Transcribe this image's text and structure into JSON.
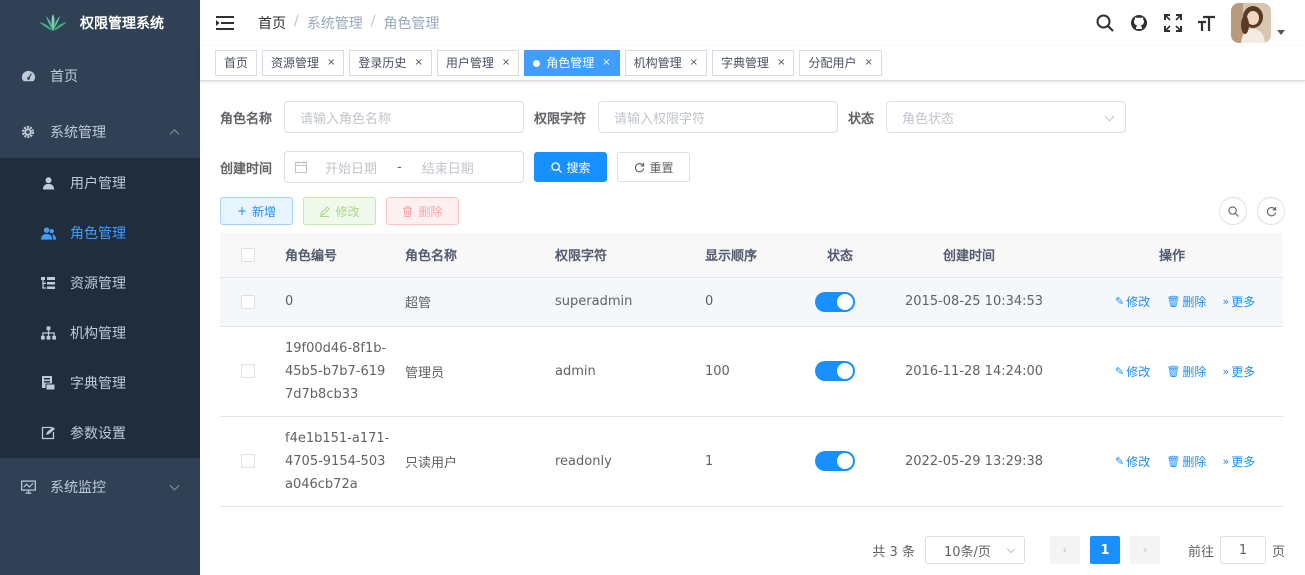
{
  "app": {
    "title": "权限管理系统"
  },
  "sidebar": {
    "home": "首页",
    "system": "系统管理",
    "items": [
      "用户管理",
      "角色管理",
      "资源管理",
      "机构管理",
      "字典管理",
      "参数设置"
    ],
    "monitor": "系统监控"
  },
  "breadcrumb": [
    "首页",
    "系统管理",
    "角色管理"
  ],
  "tags": [
    {
      "label": "首页",
      "closable": false,
      "active": false
    },
    {
      "label": "资源管理",
      "closable": true,
      "active": false
    },
    {
      "label": "登录历史",
      "closable": true,
      "active": false
    },
    {
      "label": "用户管理",
      "closable": true,
      "active": false
    },
    {
      "label": "角色管理",
      "closable": true,
      "active": true
    },
    {
      "label": "机构管理",
      "closable": true,
      "active": false
    },
    {
      "label": "字典管理",
      "closable": true,
      "active": false
    },
    {
      "label": "分配用户",
      "closable": true,
      "active": false
    }
  ],
  "search": {
    "role_name_label": "角色名称",
    "role_name_placeholder": "请输入角色名称",
    "role_key_label": "权限字符",
    "role_key_placeholder": "请输入权限字符",
    "status_label": "状态",
    "status_placeholder": "角色状态",
    "created_label": "创建时间",
    "start_placeholder": "开始日期",
    "range_sep": "-",
    "end_placeholder": "结束日期",
    "search_btn": "搜索",
    "reset_btn": "重置"
  },
  "toolbar": {
    "add": "新增",
    "edit": "修改",
    "delete": "删除"
  },
  "table": {
    "headers": [
      "角色编号",
      "角色名称",
      "权限字符",
      "显示顺序",
      "状态",
      "创建时间",
      "操作"
    ],
    "rows": [
      {
        "id": [
          "0"
        ],
        "name": "超管",
        "key": "superadmin",
        "sort": "0",
        "status": true,
        "created": "2015-08-25 10:34:53"
      },
      {
        "id": [
          "19f00d46-8f1b-",
          "45b5-b7b7-619",
          "7d7b8cb33"
        ],
        "name": "管理员",
        "key": "admin",
        "sort": "100",
        "status": true,
        "created": "2016-11-28 14:24:00"
      },
      {
        "id": [
          "f4e1b151-a171-",
          "4705-9154-503",
          "a046cb72a"
        ],
        "name": "只读用户",
        "key": "readonly",
        "sort": "1",
        "status": true,
        "created": "2022-05-29 13:29:38"
      }
    ],
    "ops": {
      "edit": "修改",
      "delete": "删除",
      "more": "更多"
    }
  },
  "pagination": {
    "total": "共 3 条",
    "page_size": "10条/页",
    "current": "1",
    "goto_prefix": "前往",
    "goto_value": "1",
    "goto_suffix": "页"
  },
  "colors": {
    "sidebar": "#304156",
    "submenu": "#1f2d3d",
    "primary": "#1890ff",
    "tag_active": "#409eff"
  }
}
